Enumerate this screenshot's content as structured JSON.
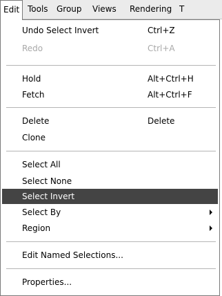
{
  "menubar": {
    "items": [
      {
        "label": "Edit"
      },
      {
        "label": "Tools"
      },
      {
        "label": "Group"
      },
      {
        "label": "Views"
      },
      {
        "label": "Rendering"
      },
      {
        "label": "T"
      }
    ]
  },
  "menu": {
    "items": [
      {
        "label": "Undo Select Invert",
        "shortcut": "Ctrl+Z"
      },
      {
        "label": "Redo",
        "shortcut": "Ctrl+A"
      },
      {
        "label": "Hold",
        "shortcut": "Alt+Ctrl+H"
      },
      {
        "label": "Fetch",
        "shortcut": "Alt+Ctrl+F"
      },
      {
        "label": "Delete",
        "shortcut": "Delete"
      },
      {
        "label": "Clone"
      },
      {
        "label": "Select All"
      },
      {
        "label": "Select None"
      },
      {
        "label": "Select Invert"
      },
      {
        "label": "Select By"
      },
      {
        "label": "Region"
      },
      {
        "label": "Edit Named Selections..."
      },
      {
        "label": "Properties..."
      }
    ]
  },
  "colors": {
    "highlight": "#444444",
    "disabled_text": "#a9a9a9",
    "menubar_bg": "#ebebeb"
  }
}
